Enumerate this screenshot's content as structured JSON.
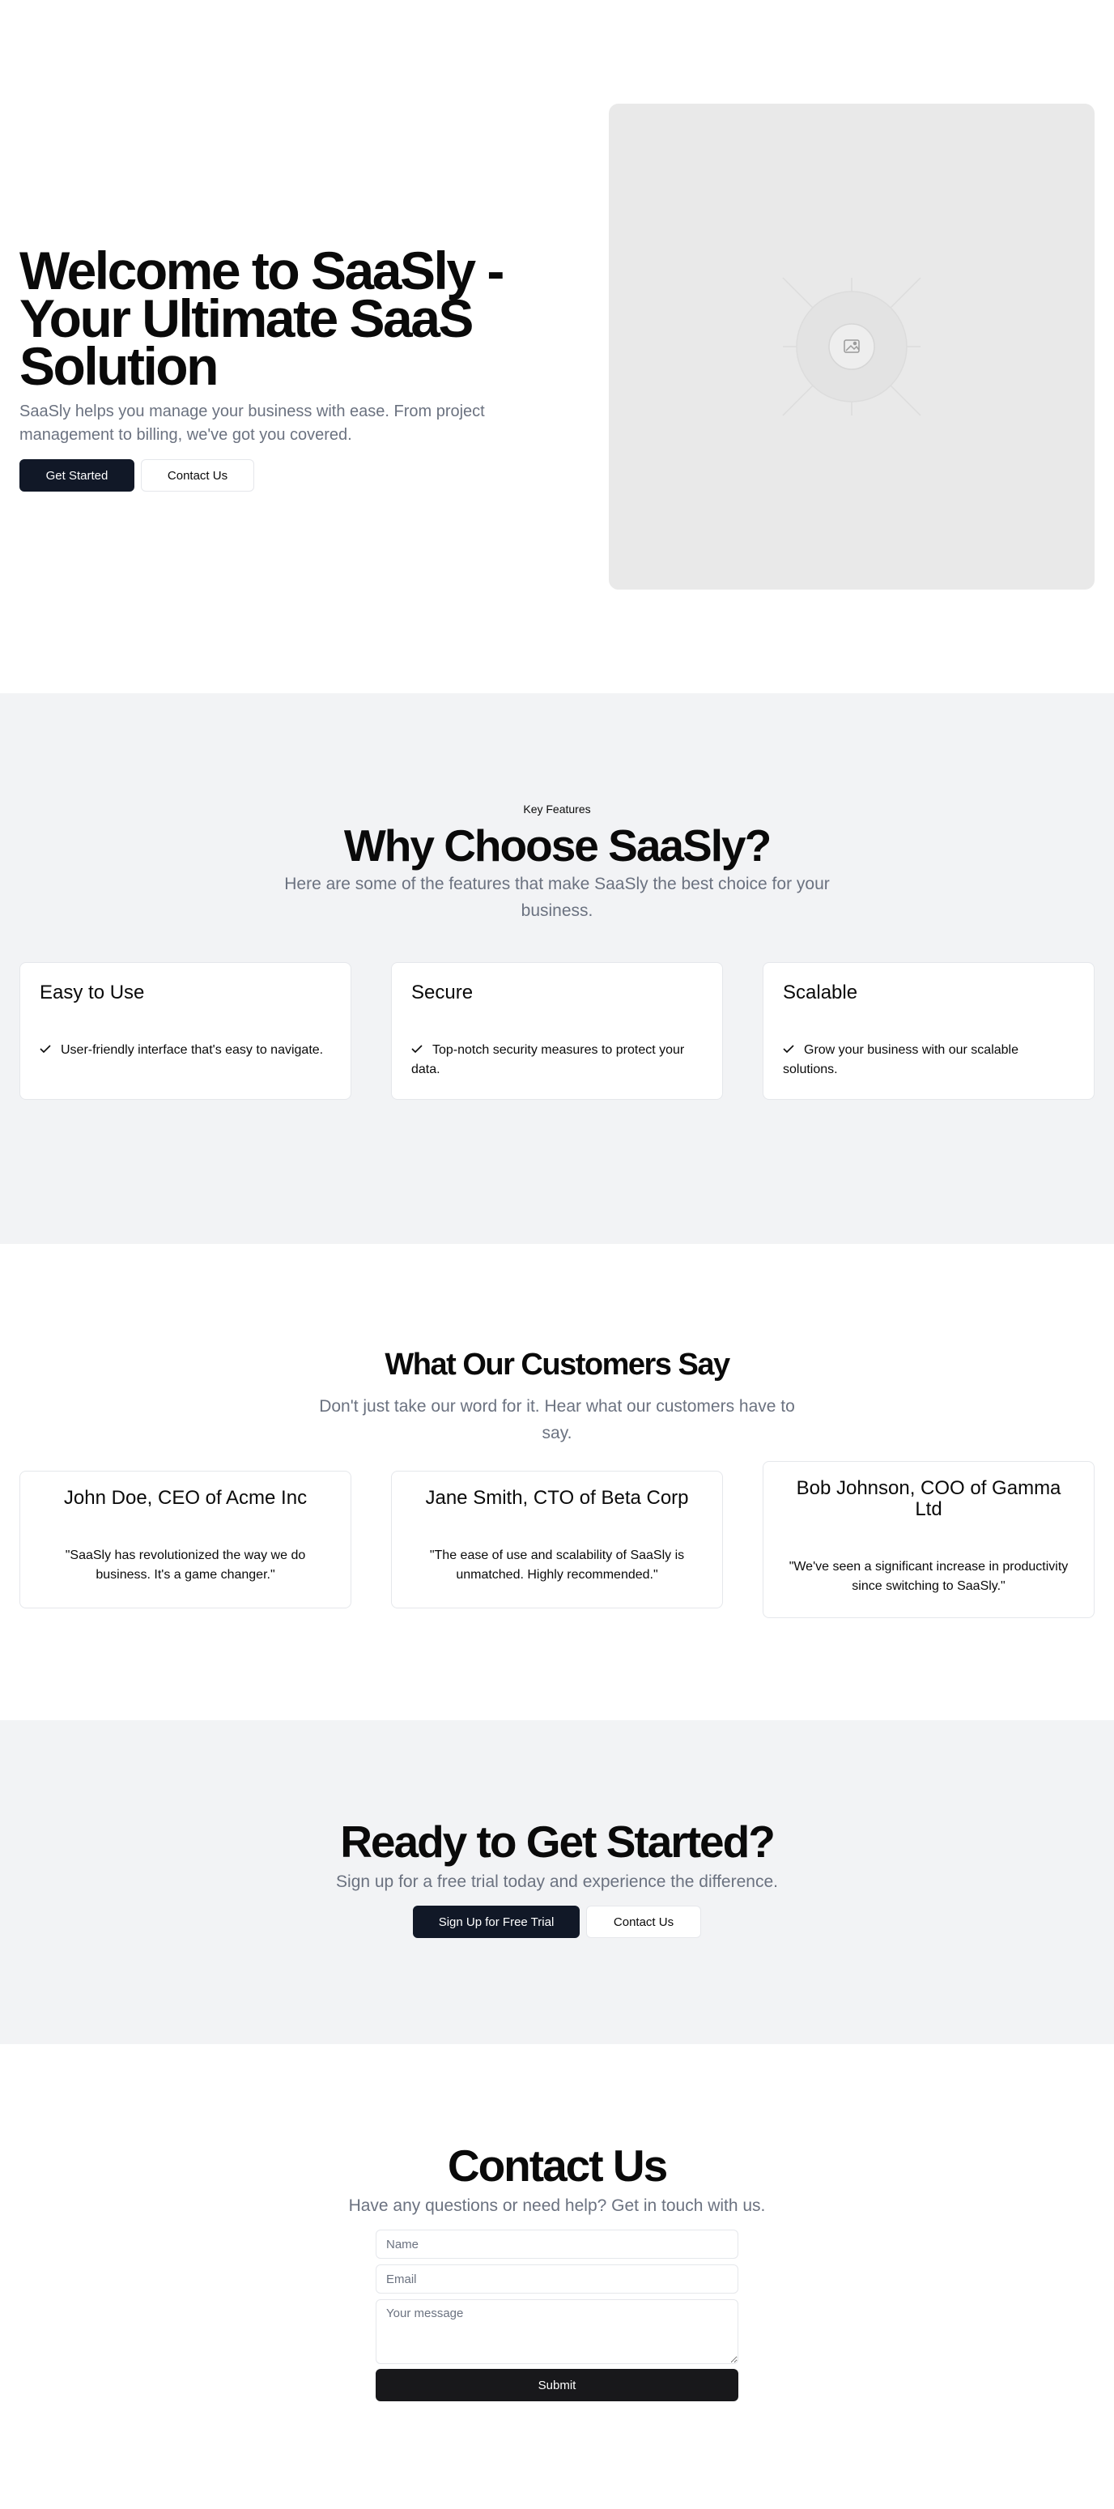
{
  "hero": {
    "title": "Welcome to SaaSly - Your Ultimate SaaS Solution",
    "subtitle": "SaaSly helps you manage your business with ease. From project management to billing, we've got you covered.",
    "primary_button": "Get Started",
    "secondary_button": "Contact Us",
    "image_icon": "image-placeholder-icon"
  },
  "features": {
    "eyebrow": "Key Features",
    "title": "Why Choose SaaSly?",
    "subtitle": "Here are some of the features that make SaaSly the best choice for your business.",
    "check_icon": "check-icon",
    "items": [
      {
        "title": "Easy to Use",
        "text": "User-friendly interface that's easy to navigate."
      },
      {
        "title": "Secure",
        "text": "Top-notch security measures to protect your data."
      },
      {
        "title": "Scalable",
        "text": "Grow your business with our scalable solutions."
      }
    ]
  },
  "testimonials": {
    "title": "What Our Customers Say",
    "subtitle": "Don't just take our word for it. Hear what our customers have to say.",
    "items": [
      {
        "name": "John Doe, CEO of Acme Inc",
        "quote": "\"SaaSly has revolutionized the way we do business. It's a game changer.\""
      },
      {
        "name": "Jane Smith, CTO of Beta Corp",
        "quote": "\"The ease of use and scalability of SaaSly is unmatched. Highly recommended.\""
      },
      {
        "name": "Bob Johnson, COO of Gamma Ltd",
        "quote": "\"We've seen a significant increase in productivity since switching to SaaSly.\""
      }
    ]
  },
  "cta": {
    "title": "Ready to Get Started?",
    "subtitle": "Sign up for a free trial today and experience the difference.",
    "primary_button": "Sign Up for Free Trial",
    "secondary_button": "Contact Us"
  },
  "contact": {
    "title": "Contact Us",
    "subtitle": "Have any questions or need help? Get in touch with us.",
    "name_placeholder": "Name",
    "email_placeholder": "Email",
    "message_placeholder": "Your message",
    "submit_button": "Submit"
  },
  "colors": {
    "primary_dark": "#111827",
    "submit_dark": "#18181b",
    "muted_text": "#6b7280",
    "section_gray": "#f2f3f5",
    "border": "#e5e7eb"
  }
}
